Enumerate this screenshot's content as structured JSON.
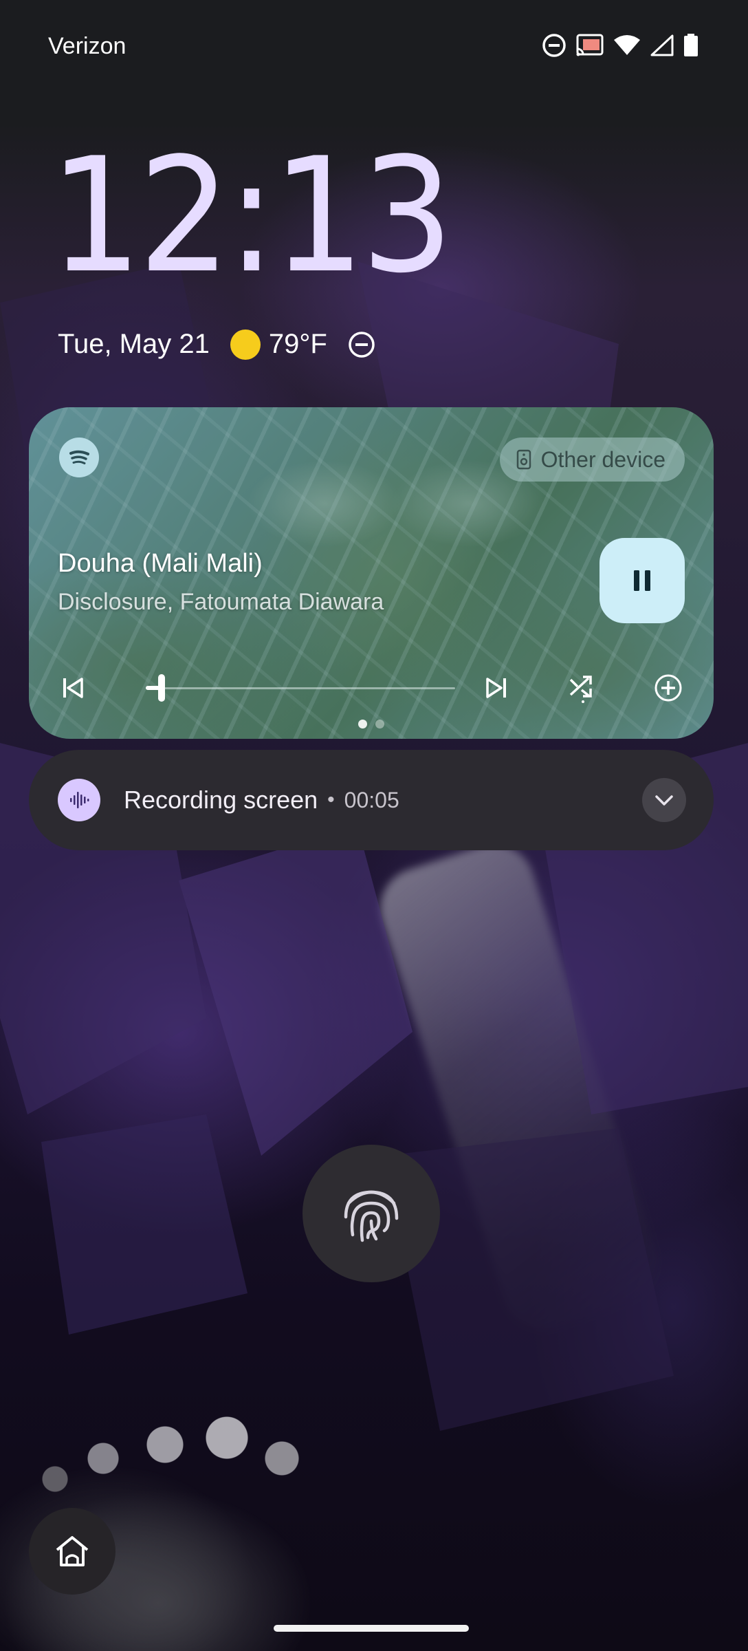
{
  "status_bar": {
    "carrier": "Verizon",
    "icons": [
      "dnd-icon",
      "cast-icon",
      "wifi-icon",
      "signal-icon",
      "battery-icon"
    ]
  },
  "lockscreen": {
    "time": "12:13",
    "date": "Tue, May 21",
    "weather_icon": "sun-icon",
    "temperature": "79°F",
    "dnd_icon": "dnd-icon"
  },
  "media": {
    "app_icon": "spotify-icon",
    "output_device": "Other device",
    "title": "Douha (Mali Mali)",
    "artist": "Disclosure, Fatoumata Diawara",
    "progress": 0.05,
    "controls": [
      "previous-icon",
      "pause-icon",
      "next-icon",
      "shuffle-icon",
      "add-icon"
    ],
    "page_count": 2,
    "page_active": 0
  },
  "notification": {
    "icon": "sound-wave-icon",
    "title": "Recording screen",
    "separator": "•",
    "elapsed": "00:05"
  },
  "colors": {
    "clock": "#e6dcff",
    "sun": "#f6cc1c",
    "pause_button": "#cdeef8",
    "record_icon_bg": "#d9c8ff",
    "notification_bg": "#2c2a30"
  }
}
